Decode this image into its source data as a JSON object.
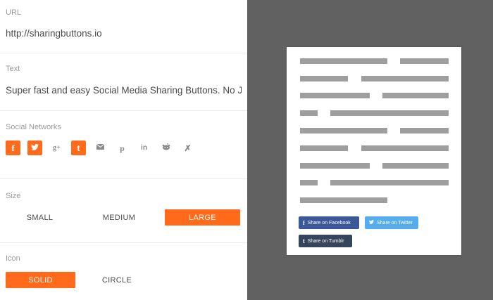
{
  "url_section": {
    "label": "URL",
    "value": "http://sharingbuttons.io"
  },
  "text_section": {
    "label": "Text",
    "value": "Super fast and easy Social Media Sharing Buttons. No JavaScript. No tracking."
  },
  "networks_section": {
    "label": "Social Networks",
    "items": [
      {
        "name": "facebook",
        "glyph": "f",
        "active": true
      },
      {
        "name": "twitter",
        "glyph": "🐦",
        "active": true
      },
      {
        "name": "google-plus",
        "glyph": "g+",
        "active": false
      },
      {
        "name": "tumblr",
        "glyph": "t",
        "active": true
      },
      {
        "name": "email",
        "glyph": "✉",
        "active": false
      },
      {
        "name": "pinterest",
        "glyph": "℗",
        "active": false
      },
      {
        "name": "linkedin",
        "glyph": "in",
        "active": false
      },
      {
        "name": "reddit",
        "glyph": "👾",
        "active": false
      },
      {
        "name": "xing",
        "glyph": "✗",
        "active": false
      }
    ]
  },
  "size_section": {
    "label": "Size",
    "options": [
      "SMALL",
      "MEDIUM",
      "LARGE"
    ],
    "selected": "LARGE"
  },
  "icon_section": {
    "label": "Icon",
    "options": [
      "SOLID",
      "CIRCLE"
    ],
    "selected": "SOLID"
  },
  "preview": {
    "facebook_button": {
      "icon": "f",
      "label": "Share on Facebook"
    },
    "twitter_button": {
      "icon": "🐦",
      "label": "Share on Twitter"
    },
    "tumblr_button": {
      "icon": "t",
      "label": "Share on Tumblr"
    }
  },
  "colors": {
    "accent": "#ff6b1a",
    "preview_background": "#616161",
    "facebook": "#3b5998",
    "twitter": "#55acee",
    "tumblr": "#35465c"
  }
}
